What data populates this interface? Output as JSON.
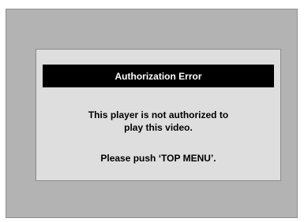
{
  "dialog": {
    "title": "Authorization Error",
    "message_line1": "This player is not authorized to",
    "message_line2": "play this video.",
    "instruction": "Please push ‘TOP MENU’."
  },
  "colors": {
    "screen_background": "#b3b3b3",
    "dialog_background": "#dedede",
    "title_background": "#000000",
    "title_text": "#ffffff"
  }
}
